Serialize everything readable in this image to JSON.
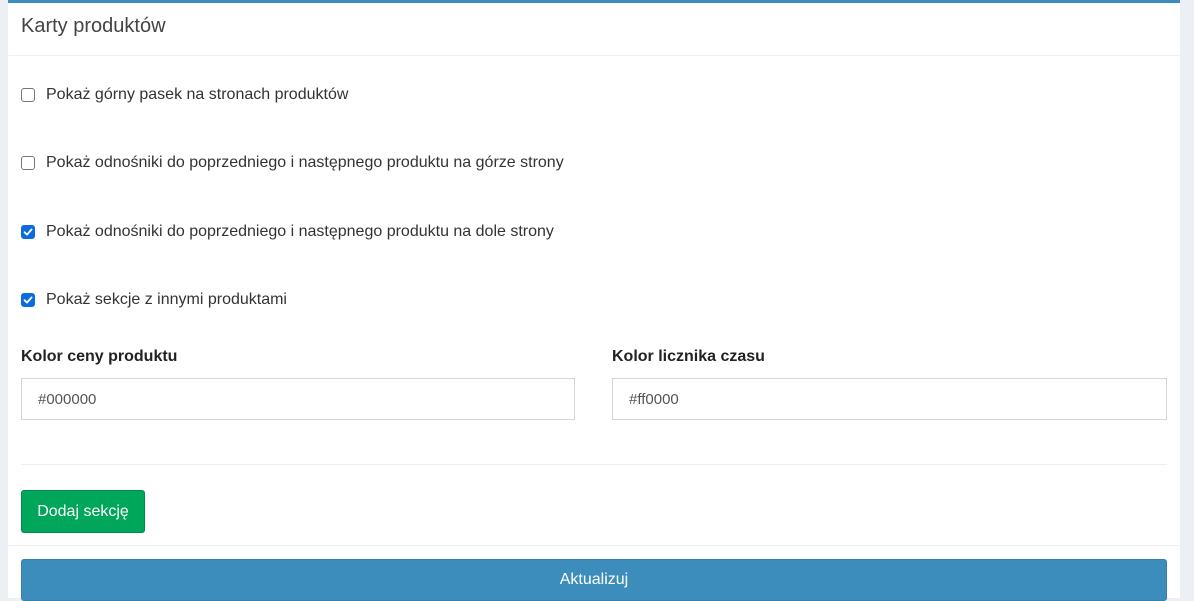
{
  "panel": {
    "title": "Karty produktów"
  },
  "checkboxes": [
    {
      "label": "Pokaż górny pasek na stronach produktów",
      "checked": false
    },
    {
      "label": "Pokaż odnośniki do poprzedniego i następnego produktu na górze strony",
      "checked": false
    },
    {
      "label": "Pokaż odnośniki do poprzedniego i następnego produktu na dole strony",
      "checked": true
    },
    {
      "label": "Pokaż sekcje z innymi produktami",
      "checked": true
    }
  ],
  "fields": {
    "price_color": {
      "label": "Kolor ceny produktu",
      "value": "#000000"
    },
    "timer_color": {
      "label": "Kolor licznika czasu",
      "value": "#ff0000"
    }
  },
  "buttons": {
    "add_section": "Dodaj sekcję",
    "update": "Aktualizuj"
  },
  "colors": {
    "accent": "#3c8dbc",
    "success": "#00a65a",
    "checkbox_checked": "#0a6cdd"
  }
}
